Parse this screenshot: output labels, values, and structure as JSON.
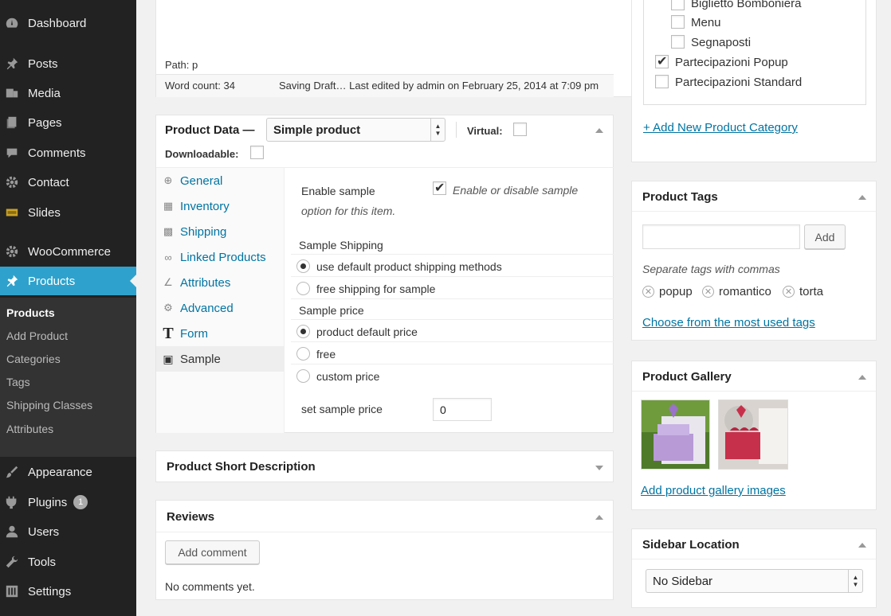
{
  "sidebar": {
    "items": [
      {
        "label": "Dashboard",
        "icon": "dashboard-icon"
      },
      {
        "label": "Posts",
        "icon": "pushpin-icon"
      },
      {
        "label": "Media",
        "icon": "media-icon"
      },
      {
        "label": "Pages",
        "icon": "pages-icon"
      },
      {
        "label": "Comments",
        "icon": "comment-icon"
      },
      {
        "label": "Contact",
        "icon": "gear-icon"
      },
      {
        "label": "Slides",
        "icon": "slides-icon"
      },
      {
        "label": "WooCommerce",
        "icon": "gear-icon"
      },
      {
        "label": "Products",
        "icon": "pushpin-icon"
      },
      {
        "label": "Appearance",
        "icon": "paintbrush-icon"
      },
      {
        "label": "Plugins",
        "icon": "plug-icon",
        "badge": "1"
      },
      {
        "label": "Users",
        "icon": "user-icon"
      },
      {
        "label": "Tools",
        "icon": "wrench-icon"
      },
      {
        "label": "Settings",
        "icon": "settings-icon"
      }
    ],
    "submenu": [
      "Products",
      "Add Product",
      "Categories",
      "Tags",
      "Shipping Classes",
      "Attributes"
    ]
  },
  "editor": {
    "path": "Path: p",
    "word_count": "Word count: 34",
    "status": "Saving Draft… Last edited by admin on February 25, 2014 at 7:09 pm"
  },
  "product_data": {
    "title": "Product Data —",
    "type_select": "Simple product",
    "virtual_label": "Virtual:",
    "downloadable_label": "Downloadable:",
    "tabs": [
      "General",
      "Inventory",
      "Shipping",
      "Linked Products",
      "Attributes",
      "Advanced",
      "Form",
      "Sample"
    ],
    "enable_sample_label": "Enable sample",
    "enable_sample_desc_1": "Enable or disable sample",
    "enable_sample_desc_2": "option for this item.",
    "sample_shipping_label": "Sample Shipping",
    "shipping_opt_1": "use default product shipping methods",
    "shipping_opt_2": "free shipping for sample",
    "sample_price_label": "Sample price",
    "price_opt_1": "product default price",
    "price_opt_2": "free",
    "price_opt_3": "custom price",
    "set_price_label": "set sample price",
    "set_price_value": "0"
  },
  "short_description": {
    "title": "Product Short Description"
  },
  "reviews": {
    "title": "Reviews",
    "add_comment": "Add comment",
    "empty": "No comments yet."
  },
  "categories": {
    "items": [
      {
        "label": "Biglietto Bomboniera",
        "checked": false
      },
      {
        "label": "Menu",
        "checked": false
      },
      {
        "label": "Segnaposti",
        "checked": false
      },
      {
        "label": "Partecipazioni Popup",
        "checked": true
      },
      {
        "label": "Partecipazioni Standard",
        "checked": false
      }
    ],
    "add_new": "+ Add New Product Category"
  },
  "tags": {
    "title": "Product Tags",
    "add_button": "Add",
    "hint": "Separate tags with commas",
    "items": [
      "popup",
      "romantico",
      "torta"
    ],
    "choose_link": "Choose from the most used tags"
  },
  "gallery": {
    "title": "Product Gallery",
    "add_link": "Add product gallery images"
  },
  "sidebar_location": {
    "title": "Sidebar Location",
    "select_value": "No Sidebar"
  },
  "colors": {
    "menu_bg": "#222222",
    "menu_current": "#2ea2cc",
    "link": "#0074a2"
  }
}
